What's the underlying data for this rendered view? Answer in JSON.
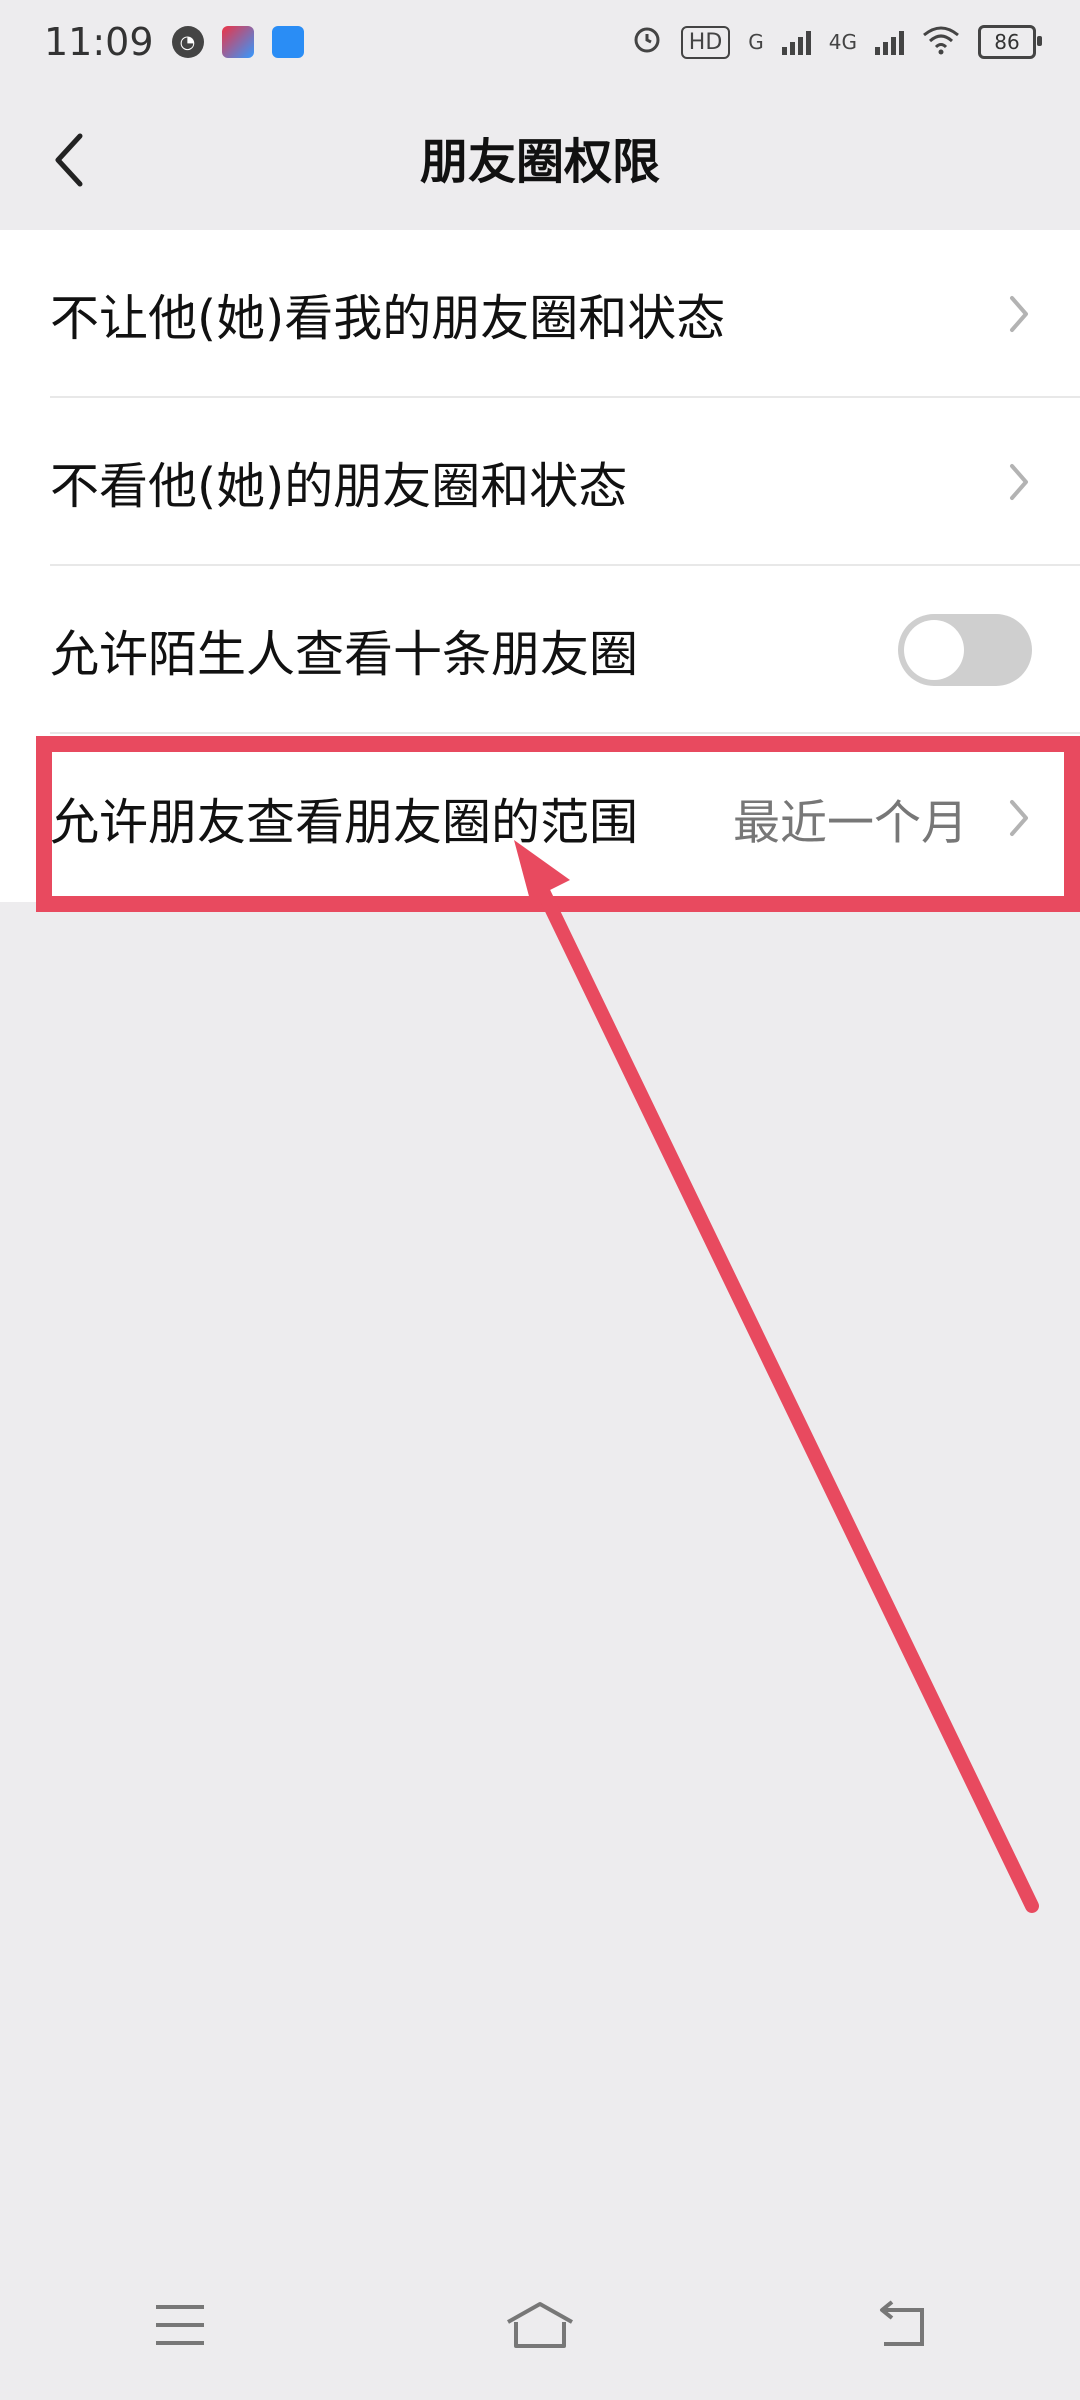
{
  "status_bar": {
    "time": "11:09",
    "net_2g": "G",
    "net_4g": "4G",
    "hd": "HD",
    "battery": "86"
  },
  "header": {
    "title": "朋友圈权限"
  },
  "rows": [
    {
      "label": "不让他(她)看我的朋友圈和状态"
    },
    {
      "label": "不看他(她)的朋友圈和状态"
    },
    {
      "label": "允许陌生人查看十条朋友圈",
      "toggle_on": false
    },
    {
      "label": "允许朋友查看朋友圈的范围",
      "value": "最近一个月"
    }
  ],
  "annotation": {
    "color": "#E84A5F"
  }
}
